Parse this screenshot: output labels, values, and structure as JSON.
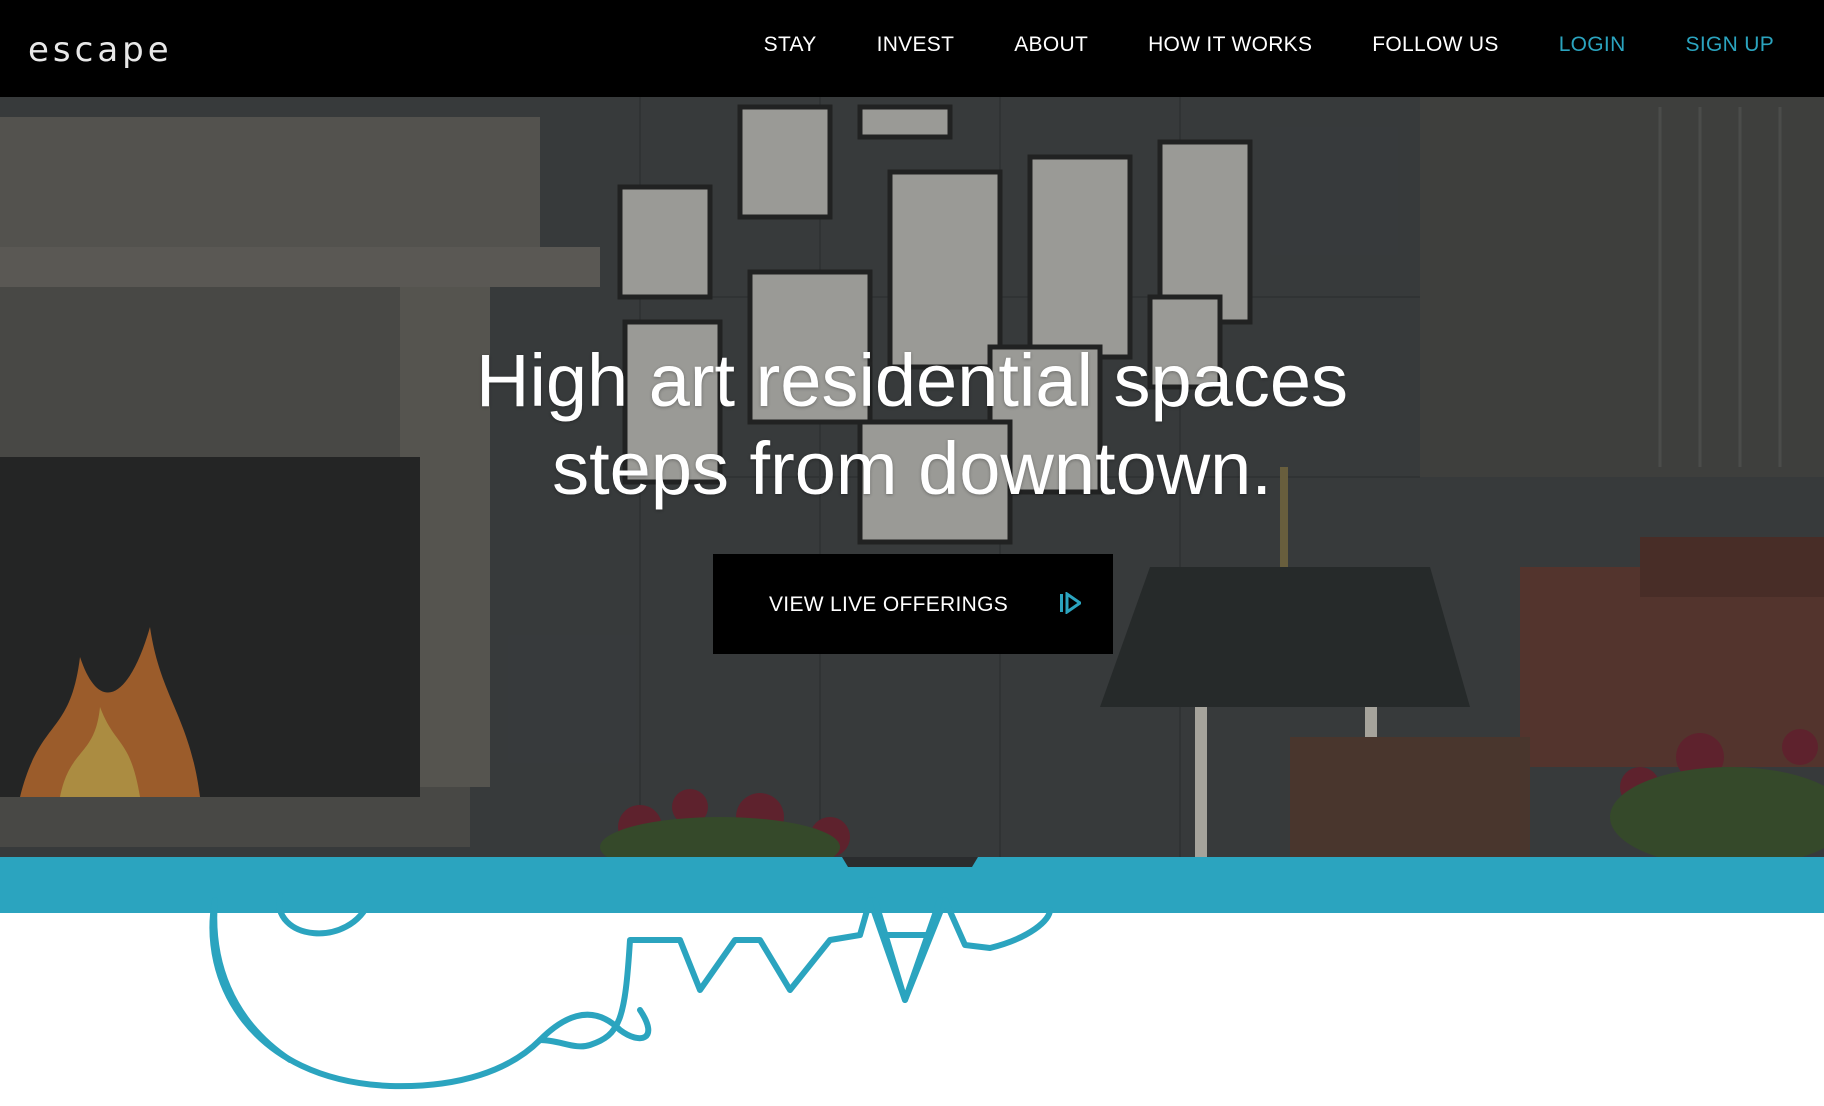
{
  "brand": {
    "logo_text": "escape",
    "accent_color": "#2ba4bf"
  },
  "nav": {
    "items": [
      {
        "label": "STAY"
      },
      {
        "label": "INVEST"
      },
      {
        "label": "ABOUT"
      },
      {
        "label": "HOW IT WORKS"
      },
      {
        "label": "FOLLOW US"
      }
    ],
    "login_label": "LOGIN",
    "signup_label": "SIGN UP"
  },
  "hero": {
    "title_line1": "High art residential spaces",
    "title_line2": "steps from downtown.",
    "cta_label": "VIEW LIVE OFFERINGS",
    "cta_icon": "play-skip-icon"
  },
  "footer_graphic": {
    "icon": "key-line-icon"
  }
}
